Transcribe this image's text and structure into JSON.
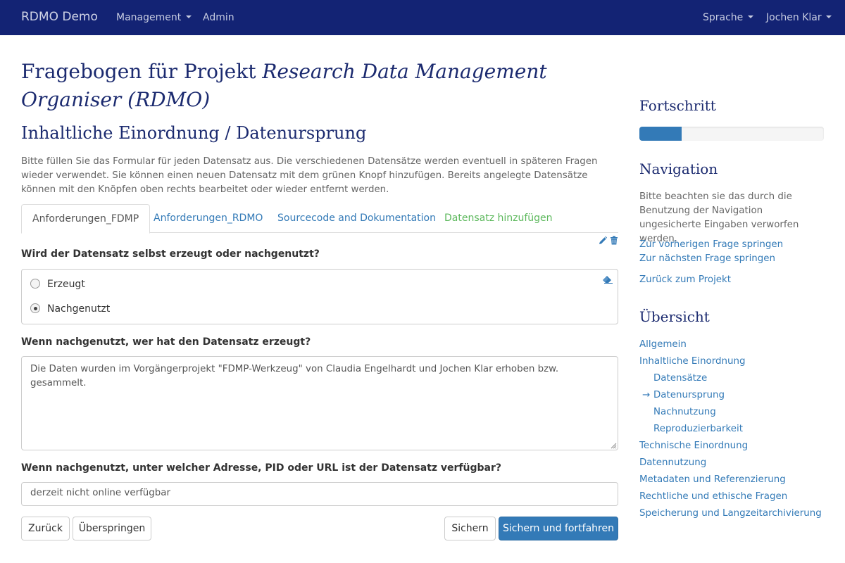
{
  "navbar": {
    "brand": "RDMO Demo",
    "management": "Management",
    "admin": "Admin",
    "language": "Sprache",
    "user": "Jochen Klar"
  },
  "page": {
    "title_prefix": "Fragebogen für Projekt ",
    "title_project": "Research Data Management Organiser (RDMO)",
    "section_title": "Inhaltliche Einordnung / Datenursprung",
    "help_text": "Bitte füllen Sie das Formular für jeden Datensatz aus. Die verschiedenen Datensätze werden eventuell in späteren Fragen wieder verwendet. Sie können einen neuen Datensatz mit dem grünen Knopf hinzufügen. Bereits angelegte Datensätze können mit den Knöpfen oben rechts bearbeitet oder wieder entfernt werden."
  },
  "tabs": [
    {
      "label": "Anforderungen_FDMP",
      "active": true
    },
    {
      "label": "Anforderungen_RDMO",
      "active": false
    },
    {
      "label": "Sourcecode and Dokumentation",
      "active": false
    },
    {
      "label": "Datensatz hinzufügen",
      "active": false
    }
  ],
  "questions": {
    "q1": {
      "label": "Wird der Datensatz selbst erzeugt oder nachgenutzt?",
      "options": [
        "Erzeugt",
        "Nachgenutzt"
      ],
      "selected": "Nachgenutzt"
    },
    "q2": {
      "label": "Wenn nachgenutzt, wer hat den Datensatz erzeugt?",
      "value": "Die Daten wurden im Vorgängerprojekt \"FDMP-Werkzeug\" von Claudia Engelhardt und Jochen Klar erhoben bzw. gesammelt."
    },
    "q3": {
      "label": "Wenn nachgenutzt, unter welcher Adresse, PID oder URL ist der Datensatz verfügbar?",
      "value": "derzeit nicht online verfügbar"
    }
  },
  "buttons": {
    "back": "Zurück",
    "skip": "Überspringen",
    "save": "Sichern",
    "save_continue": "Sichern und fortfahren"
  },
  "sidebar": {
    "progress_title": "Fortschritt",
    "progress_fraction": 0.23,
    "navigation_title": "Navigation",
    "navigation_text": "Bitte beachten sie das durch die Benutzung der Navigation ungesicherte Eingaben verworfen werden.",
    "prev_link": "Zur vorherigen Frage springen",
    "next_link": "Zur nächsten Frage springen",
    "back_to_project": "Zurück zum Projekt",
    "overview_title": "Übersicht",
    "current_marker": "→",
    "overview": [
      {
        "label": "Allgemein",
        "level": 0
      },
      {
        "label": "Inhaltliche Einordnung",
        "level": 0
      },
      {
        "label": "Datensätze",
        "level": 1
      },
      {
        "label": "Datenursprung",
        "level": 1,
        "current": true
      },
      {
        "label": "Nachnutzung",
        "level": 1
      },
      {
        "label": "Reproduzierbarkeit",
        "level": 1
      },
      {
        "label": "Technische Einordnung",
        "level": 0
      },
      {
        "label": "Datennutzung",
        "level": 0
      },
      {
        "label": "Metadaten und Referenzierung",
        "level": 0
      },
      {
        "label": "Rechtliche und ethische Fragen",
        "level": 0
      },
      {
        "label": "Speicherung und Langzeitarchivierung",
        "level": 0
      }
    ]
  },
  "colors": {
    "navbar": "#132374",
    "heading": "#1b2a6f",
    "link": "#337ab7",
    "add": "#5cb85c"
  }
}
